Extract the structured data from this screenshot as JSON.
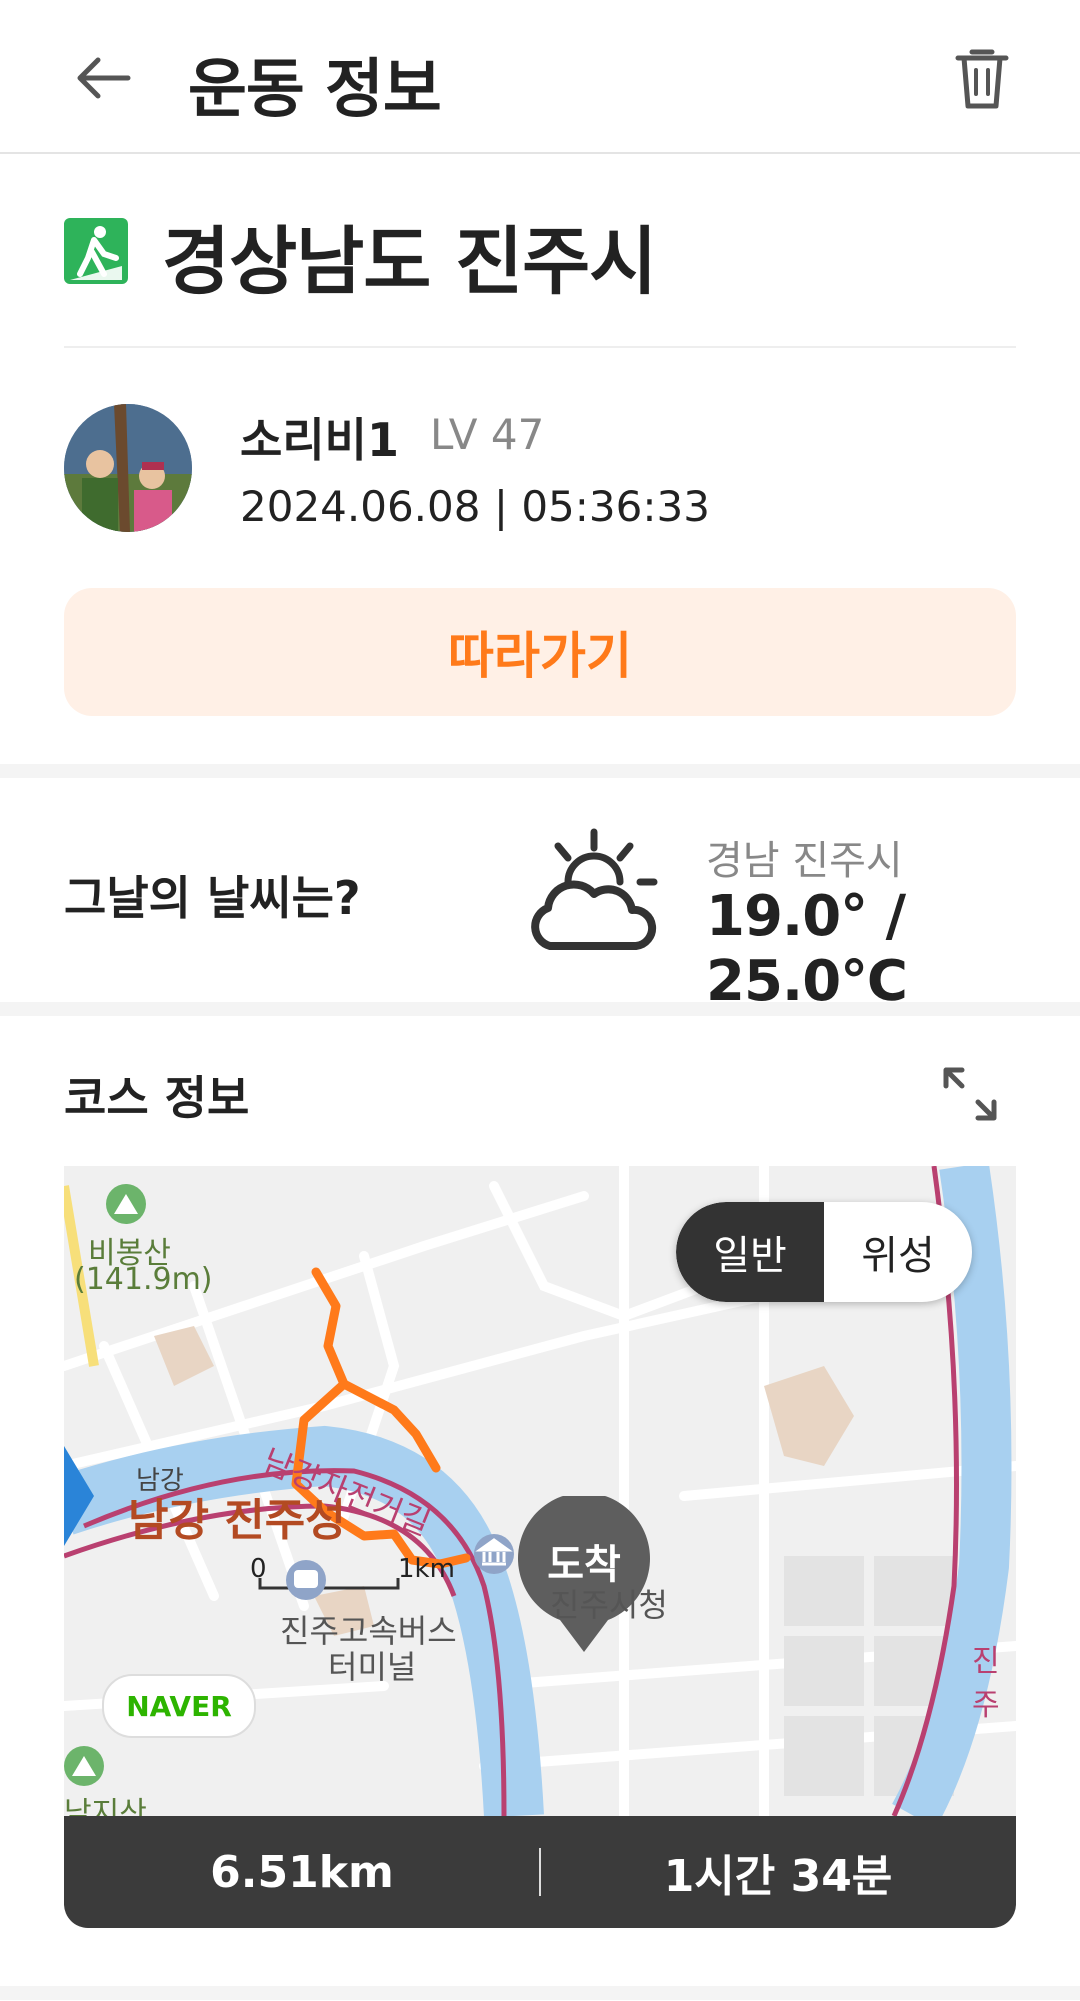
{
  "header": {
    "title": "운동 정보"
  },
  "location": {
    "title": "경상남도 진주시"
  },
  "user": {
    "name": "소리비1",
    "level": "LV 47",
    "datetime": "2024.06.08 | 05:36:33"
  },
  "follow_label": "따라가기",
  "weather": {
    "question": "그날의 날씨는?",
    "location": "경남 진주시",
    "temp": "19.0° / 25.0℃",
    "icon": "partly-cloudy-icon"
  },
  "course": {
    "title": "코스 정보",
    "map_toggle": {
      "normal": "일반",
      "satellite": "위성",
      "selected": "일반"
    },
    "pin_label": "도착",
    "map_labels": {
      "mountain": "비봉산",
      "mountain_height": "(141.9m)",
      "river_small": "남강",
      "castle": "남강 진주성",
      "bike_road": "남강자전거길",
      "city_hall": "진주시청",
      "bus_terminal_1": "진주고속버스",
      "bus_terminal_2": "터미널",
      "scale_zero": "0",
      "scale_km": "1km",
      "edge_right": "진주",
      "edge_bottom": "남지산",
      "naver": "NAVER"
    },
    "distance": "6.51km",
    "duration": "1시간 34분"
  },
  "colors": {
    "accent": "#ff7a1a",
    "follow_bg": "#fff0e6",
    "route": "#ff7a1a",
    "stats_bg": "#3b3b3b",
    "location_icon": "#2eb35a"
  }
}
